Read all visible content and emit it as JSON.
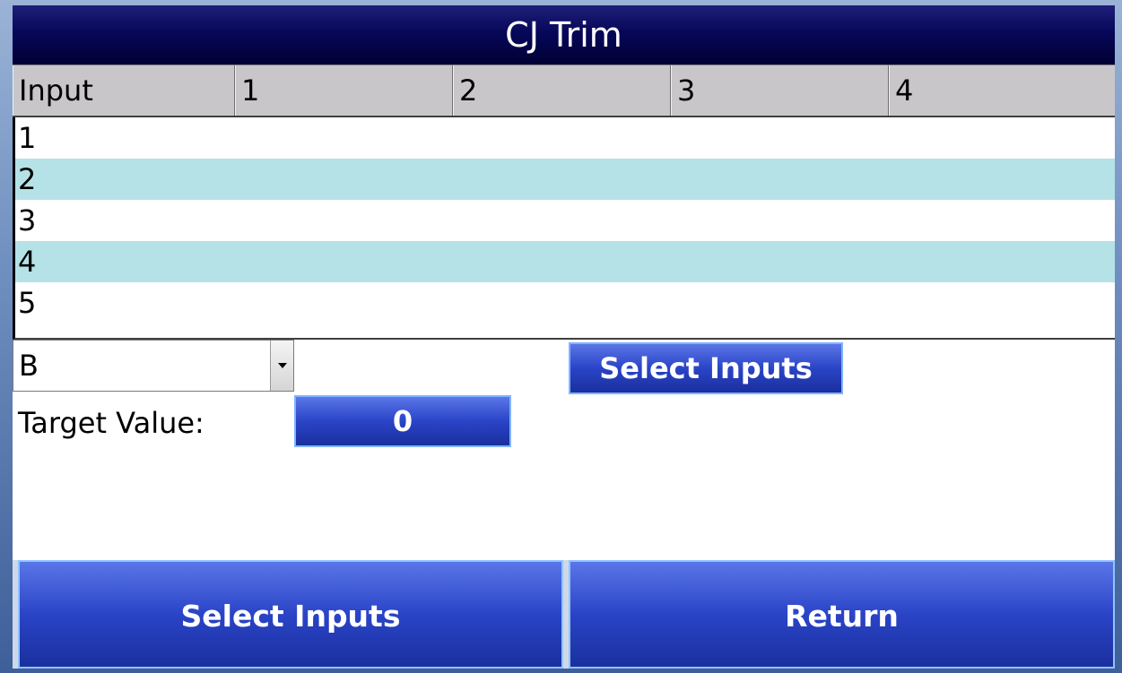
{
  "window": {
    "title": "CJ Trim"
  },
  "table": {
    "headers": [
      "Input",
      "1",
      "2",
      "3",
      "4"
    ],
    "rows": [
      "1",
      "2",
      "3",
      "4",
      "5"
    ]
  },
  "controls": {
    "selector_value": "B",
    "target_label": "Target Value:",
    "target_value": "0",
    "select_inputs_label": "Select Inputs"
  },
  "bottom": {
    "select_inputs_label": "Select Inputs",
    "return_label": "Return"
  },
  "colors": {
    "title_bar": "#07075a",
    "row_highlight": "#b5e2e6",
    "button_blue": "#2a44c7"
  }
}
